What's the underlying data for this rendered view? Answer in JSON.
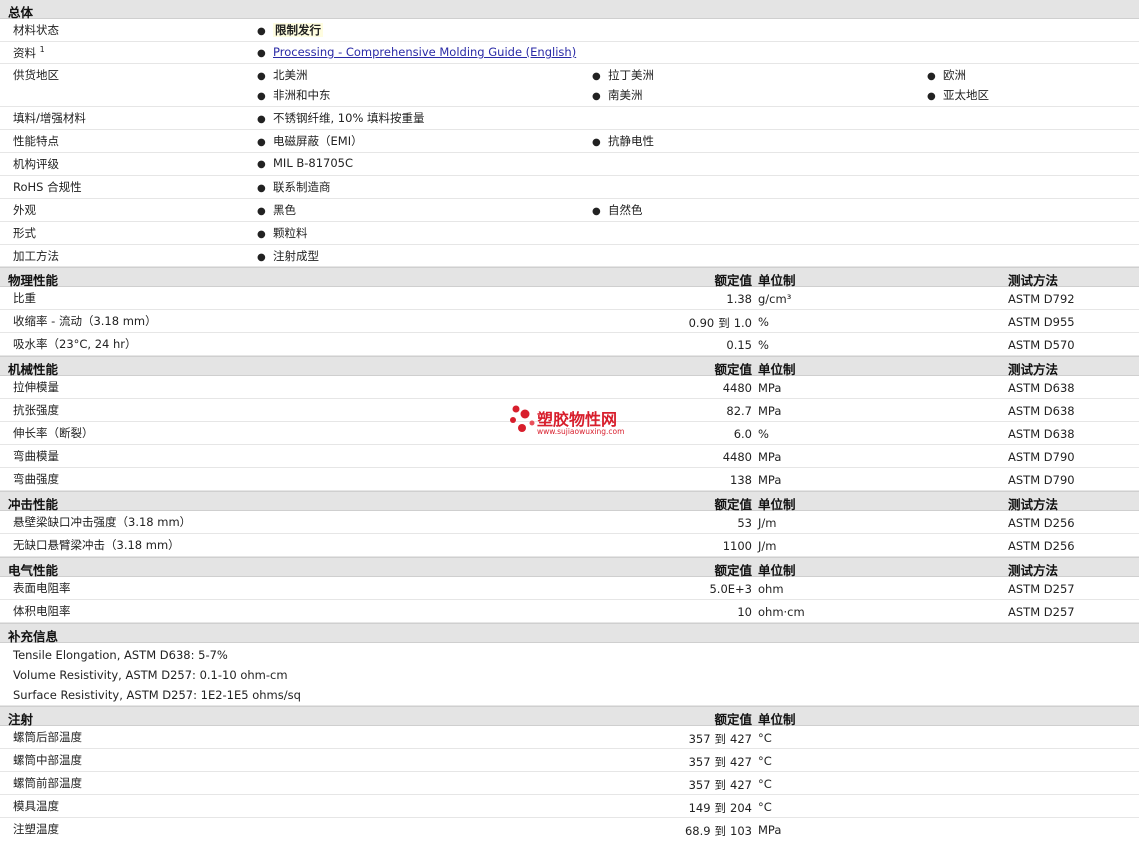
{
  "general": {
    "title": "总体",
    "rows": [
      {
        "label": "材料状态",
        "items": [
          "限制发行"
        ]
      },
      {
        "label": "资料",
        "sup": "1",
        "items": [
          "Processing - Comprehensive Molding Guide (English)"
        ]
      },
      {
        "label": "供货地区",
        "items": [
          "北美洲",
          "拉丁美洲",
          "欧洲",
          "非洲和中东",
          "南美洲",
          "亚太地区"
        ]
      },
      {
        "label": "填料/增强材料",
        "items": [
          "不锈钢纤维, 10% 填料按重量"
        ]
      },
      {
        "label": "性能特点",
        "items": [
          "电磁屏蔽（EMI）",
          "抗静电性"
        ]
      },
      {
        "label": "机构评级",
        "items": [
          "MIL B-81705C"
        ]
      },
      {
        "label": "RoHS 合规性",
        "items": [
          "联系制造商"
        ]
      },
      {
        "label": "外观",
        "items": [
          "黑色",
          "自然色"
        ]
      },
      {
        "label": "形式",
        "items": [
          "颗粒料"
        ]
      },
      {
        "label": "加工方法",
        "items": [
          "注射成型"
        ]
      }
    ]
  },
  "headers": {
    "nominal": "额定值",
    "unit": "单位制",
    "method": "测试方法"
  },
  "physical": {
    "title": "物理性能",
    "rows": [
      {
        "label": "比重",
        "value": "1.38",
        "unit": "g/cm³",
        "method": "ASTM D792"
      },
      {
        "label": "收缩率 - 流动（3.18 mm）",
        "value_from": "0.90",
        "to": "到",
        "value_to": "1.0",
        "unit": "%",
        "method": "ASTM D955"
      },
      {
        "label": "吸水率（23°C, 24 hr）",
        "value": "0.15",
        "unit": "%",
        "method": "ASTM D570"
      }
    ]
  },
  "mechanical": {
    "title": "机械性能",
    "rows": [
      {
        "label": "拉伸模量",
        "value": "4480",
        "unit": "MPa",
        "method": "ASTM D638"
      },
      {
        "label": "抗张强度",
        "value": "82.7",
        "unit": "MPa",
        "method": "ASTM D638"
      },
      {
        "label": "伸长率（断裂）",
        "value": "6.0",
        "unit": "%",
        "method": "ASTM D638"
      },
      {
        "label": "弯曲模量",
        "value": "4480",
        "unit": "MPa",
        "method": "ASTM D790"
      },
      {
        "label": "弯曲强度",
        "value": "138",
        "unit": "MPa",
        "method": "ASTM D790"
      }
    ]
  },
  "impact": {
    "title": "冲击性能",
    "rows": [
      {
        "label": "悬壁梁缺口冲击强度（3.18 mm）",
        "value": "53",
        "unit": "J/m",
        "method": "ASTM D256"
      },
      {
        "label": "无缺口悬臂梁冲击（3.18 mm）",
        "value": "1100",
        "unit": "J/m",
        "method": "ASTM D256"
      }
    ]
  },
  "electrical": {
    "title": "电气性能",
    "rows": [
      {
        "label": "表面电阻率",
        "value": "5.0E+3",
        "unit": "ohm",
        "method": "ASTM D257"
      },
      {
        "label": "体积电阻率",
        "value": "10",
        "unit": "ohm·cm",
        "method": "ASTM D257"
      }
    ]
  },
  "supplement": {
    "title": "补充信息",
    "notes": [
      "Tensile Elongation, ASTM D638: 5-7%",
      "Volume Resistivity, ASTM D257: 0.1-10 ohm-cm",
      "Surface Resistivity, ASTM D257: 1E2-1E5 ohms/sq"
    ]
  },
  "injection": {
    "title": "注射",
    "rows": [
      {
        "label": "螺筒后部温度",
        "value_from": "357",
        "to": "到",
        "value_to": "427",
        "unit": "°C"
      },
      {
        "label": "螺筒中部温度",
        "value_from": "357",
        "to": "到",
        "value_to": "427",
        "unit": "°C"
      },
      {
        "label": "螺筒前部温度",
        "value_from": "357",
        "to": "到",
        "value_to": "427",
        "unit": "°C"
      },
      {
        "label": "模具温度",
        "value_from": "149",
        "to": "到",
        "value_to": "204",
        "unit": "°C"
      },
      {
        "label": "注塑温度",
        "value_from": "68.9",
        "to": "到",
        "value_to": "103",
        "unit": "MPa"
      }
    ]
  },
  "watermark": {
    "name": "塑胶物性网",
    "url": "www.sujiaowuxing.com"
  },
  "colors": {
    "section_bg": "#e4e4e4",
    "link": "#2a2aa6",
    "watermark": "#d81e2c"
  }
}
